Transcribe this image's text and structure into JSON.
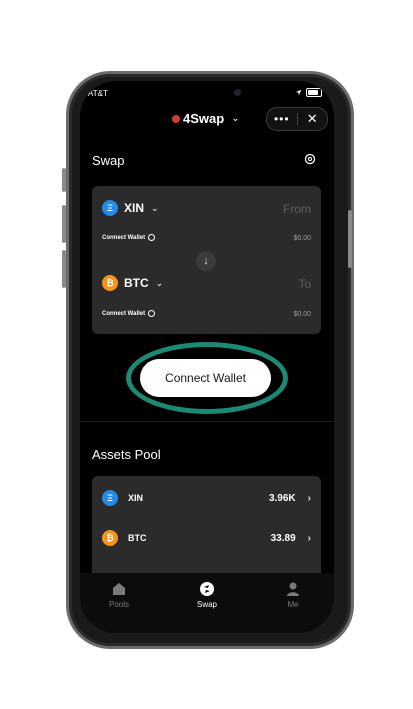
{
  "status_bar": {
    "carrier": "AT&T",
    "wifi_icon": "wifi-icon",
    "location_icon": "location-arrow-icon",
    "battery_icon": "battery-icon"
  },
  "header": {
    "app_name": "4Swap",
    "menu_icon": "more-dots-icon",
    "close_icon": "close-icon"
  },
  "swap": {
    "title": "Swap",
    "from": {
      "token": "XIN",
      "placeholder": "From",
      "connect_label": "Connect Wallet",
      "balance": "$0.00"
    },
    "to": {
      "token": "BTC",
      "placeholder": "To",
      "connect_label": "Connect Wallet",
      "balance": "$0.00"
    }
  },
  "connect_wallet_label": "Connect Wallet",
  "assets_pool": {
    "title": "Assets Pool",
    "items": [
      {
        "token": "XIN",
        "value": "3.96K"
      },
      {
        "token": "BTC",
        "value": "33.89"
      }
    ]
  },
  "bottom_nav": {
    "items": [
      {
        "label": "Pools"
      },
      {
        "label": "Swap"
      },
      {
        "label": "Me"
      }
    ]
  },
  "colors": {
    "highlight_ring": "#1b8a74",
    "xin": "#1e8ce8",
    "btc": "#f7931a",
    "card": "#2b2b2b"
  }
}
